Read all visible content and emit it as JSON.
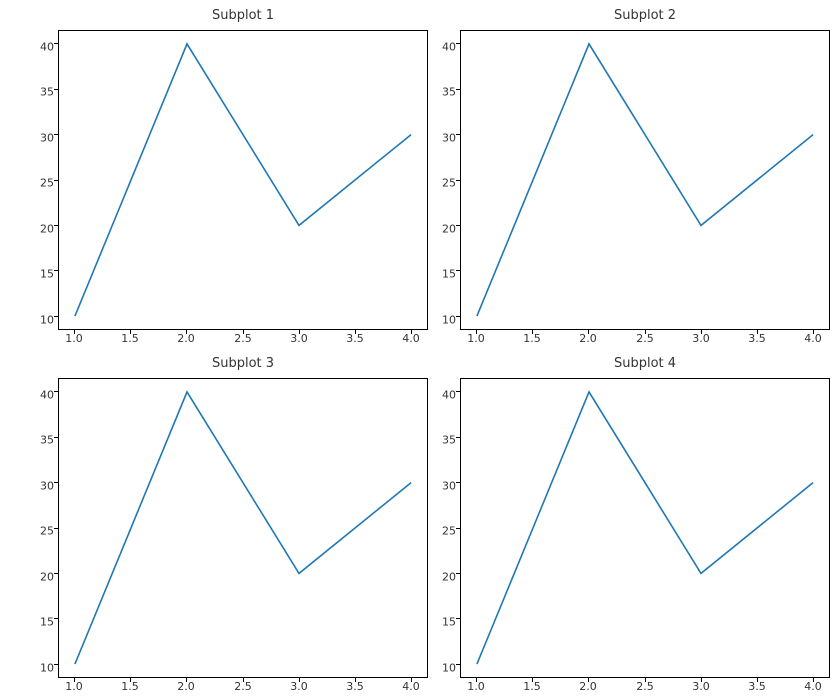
{
  "chart_data": [
    {
      "type": "line",
      "title": "Subplot 1",
      "x": [
        1,
        2,
        3,
        4
      ],
      "y": [
        10,
        40,
        20,
        30
      ],
      "xticks": [
        "1.0",
        "1.5",
        "2.0",
        "2.5",
        "3.0",
        "3.5",
        "4.0"
      ],
      "yticks": [
        "10",
        "15",
        "20",
        "25",
        "30",
        "35",
        "40"
      ],
      "xlim": [
        1.0,
        4.0
      ],
      "ylim": [
        10,
        40
      ],
      "line_color": "#1f77b4"
    },
    {
      "type": "line",
      "title": "Subplot 2",
      "x": [
        1,
        2,
        3,
        4
      ],
      "y": [
        10,
        40,
        20,
        30
      ],
      "xticks": [
        "1.0",
        "1.5",
        "2.0",
        "2.5",
        "3.0",
        "3.5",
        "4.0"
      ],
      "yticks": [
        "10",
        "15",
        "20",
        "25",
        "30",
        "35",
        "40"
      ],
      "xlim": [
        1.0,
        4.0
      ],
      "ylim": [
        10,
        40
      ],
      "line_color": "#1f77b4"
    },
    {
      "type": "line",
      "title": "Subplot 3",
      "x": [
        1,
        2,
        3,
        4
      ],
      "y": [
        10,
        40,
        20,
        30
      ],
      "xticks": [
        "1.0",
        "1.5",
        "2.0",
        "2.5",
        "3.0",
        "3.5",
        "4.0"
      ],
      "yticks": [
        "10",
        "15",
        "20",
        "25",
        "30",
        "35",
        "40"
      ],
      "xlim": [
        1.0,
        4.0
      ],
      "ylim": [
        10,
        40
      ],
      "line_color": "#1f77b4"
    },
    {
      "type": "line",
      "title": "Subplot 4",
      "x": [
        1,
        2,
        3,
        4
      ],
      "y": [
        10,
        40,
        20,
        30
      ],
      "xticks": [
        "1.0",
        "1.5",
        "2.0",
        "2.5",
        "3.0",
        "3.5",
        "4.0"
      ],
      "yticks": [
        "10",
        "15",
        "20",
        "25",
        "30",
        "35",
        "40"
      ],
      "xlim": [
        1.0,
        4.0
      ],
      "ylim": [
        10,
        40
      ],
      "line_color": "#1f77b4"
    }
  ]
}
